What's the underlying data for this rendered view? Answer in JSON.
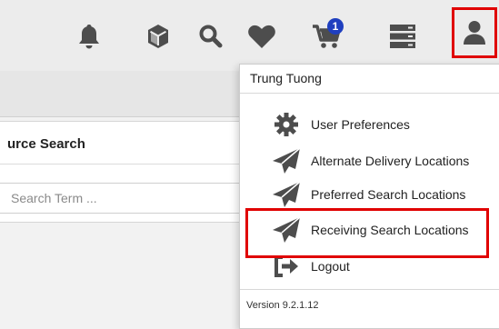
{
  "colors": {
    "icon": "#4d4d4d",
    "highlight": "#e00000",
    "badge": "#1f3fbf"
  },
  "topbar": {
    "icons": [
      "bell-icon",
      "cube-icon",
      "search-icon",
      "heart-icon",
      "cart-icon",
      "server-icon",
      "user-icon"
    ],
    "cart_badge": "1"
  },
  "panel": {
    "title": "urce Search",
    "search_placeholder": "Search Term ..."
  },
  "user_menu": {
    "user_name": "Trung Tuong",
    "items": [
      {
        "label": "User Preferences",
        "icon": "gear-icon"
      },
      {
        "label": "Alternate Delivery Locations",
        "icon": "paper-plane-icon"
      },
      {
        "label": "Preferred Search Locations",
        "icon": "paper-plane-icon"
      },
      {
        "label": "Receiving Search Locations",
        "icon": "paper-plane-icon"
      },
      {
        "label": "Logout",
        "icon": "sign-out-icon"
      }
    ],
    "version": "Version 9.2.1.12"
  }
}
